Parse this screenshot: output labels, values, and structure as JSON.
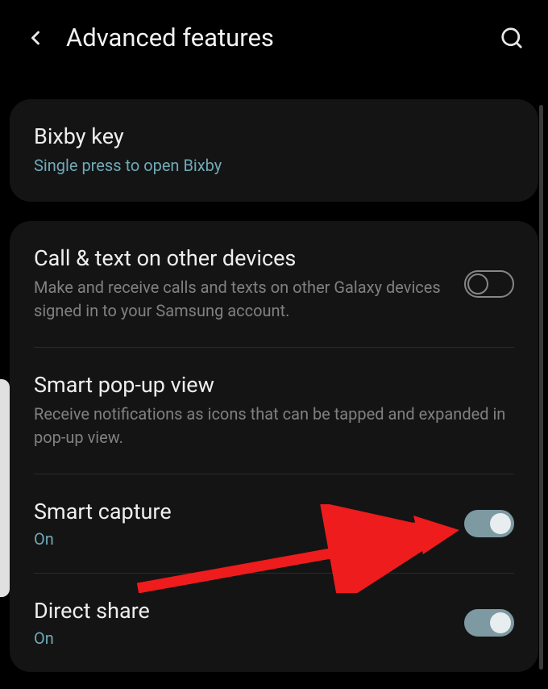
{
  "header": {
    "title": "Advanced features"
  },
  "card1": {
    "bixby": {
      "title": "Bixby key",
      "subtitle": "Single press to open Bixby"
    }
  },
  "card2": {
    "calltext": {
      "title": "Call & text on other devices",
      "subtitle": "Make and receive calls and texts on other Galaxy devices signed in to your Samsung account."
    },
    "popup": {
      "title": "Smart pop-up view",
      "subtitle": "Receive notifications as icons that can be tapped and expanded in pop-up view."
    },
    "capture": {
      "title": "Smart capture",
      "status": "On"
    },
    "directshare": {
      "title": "Direct share",
      "status": "On"
    }
  }
}
